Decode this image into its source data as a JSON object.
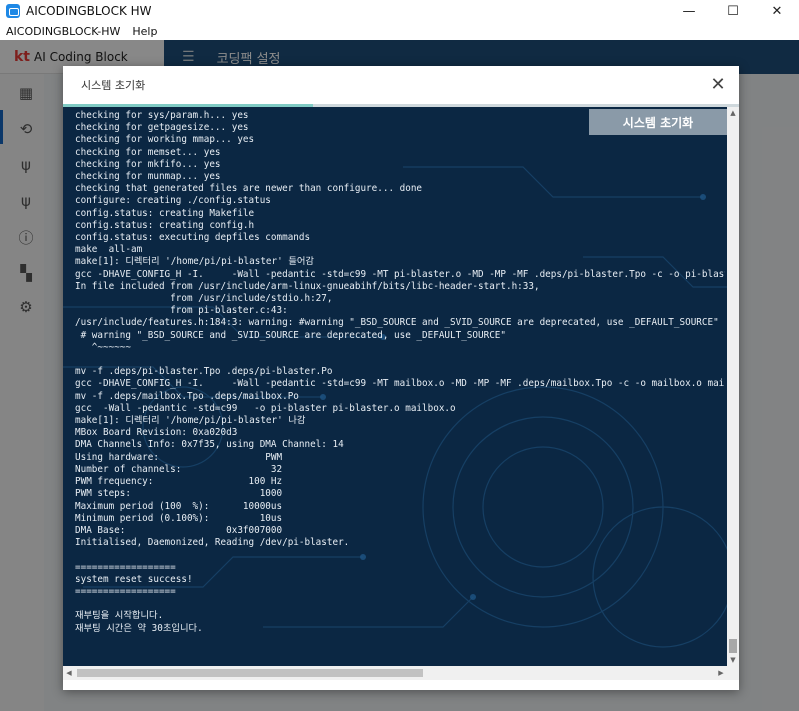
{
  "window": {
    "title": "AICODINGBLOCK HW",
    "minimize": "—",
    "maximize": "☐",
    "close": "✕"
  },
  "menu": [
    "AICODINGBLOCK-HW",
    "Help"
  ],
  "app": {
    "brand_mark": "kt",
    "brand_name": "AI Coding Block",
    "nav_title": "코딩팩 설정",
    "sidebar_icons": [
      "dashboard-icon",
      "connect-icon",
      "usb-icon",
      "usb-icon",
      "info-icon",
      "layout-icon",
      "settings-icon"
    ]
  },
  "modal": {
    "title": "시스템 초기화",
    "close": "✕",
    "reset_button": "시스템 초기화",
    "progress": 0.37,
    "log_lines": [
      "checking for sys/param.h... yes",
      "checking for getpagesize... yes",
      "checking for working mmap... yes",
      "checking for memset... yes",
      "checking for mkfifo... yes",
      "checking for munmap... yes",
      "checking that generated files are newer than configure... done",
      "configure: creating ./config.status",
      "config.status: creating Makefile",
      "config.status: creating config.h",
      "config.status: executing depfiles commands",
      "make  all-am",
      "make[1]: 디렉터리 '/home/pi/pi-blaster' 들어감",
      "gcc -DHAVE_CONFIG_H -I.     -Wall -pedantic -std=c99 -MT pi-blaster.o -MD -MP -MF .deps/pi-blaster.Tpo -c -o pi-blaster.o pi-bl",
      "In file included from /usr/include/arm-linux-gnueabihf/bits/libc-header-start.h:33,",
      "                 from /usr/include/stdio.h:27,",
      "                 from pi-blaster.c:43:",
      "/usr/include/features.h:184:3: warning: #warning \"_BSD_SOURCE and _SVID_SOURCE are deprecated, use _DEFAULT_SOURCE\" [-Wcpp]",
      " # warning \"_BSD_SOURCE and _SVID_SOURCE are deprecated, use _DEFAULT_SOURCE\"",
      "   ^~~~~~~",
      "",
      "mv -f .deps/pi-blaster.Tpo .deps/pi-blaster.Po",
      "gcc -DHAVE_CONFIG_H -I.     -Wall -pedantic -std=c99 -MT mailbox.o -MD -MP -MF .deps/mailbox.Tpo -c -o mailbox.o mailbox.c",
      "mv -f .deps/mailbox.Tpo .deps/mailbox.Po",
      "gcc  -Wall -pedantic -std=c99   -o pi-blaster pi-blaster.o mailbox.o",
      "make[1]: 디렉터리 '/home/pi/pi-blaster' 나감",
      "MBox Board Revision: 0xa020d3",
      "DMA Channels Info: 0x7f35, using DMA Channel: 14",
      "Using hardware:                   PWM",
      "Number of channels:                32",
      "PWM frequency:                 100 Hz",
      "PWM steps:                       1000",
      "Maximum period (100  %):      10000us",
      "Minimum period (0.100%):         10us",
      "DMA Base:                  0x3f007000",
      "Initialised, Daemonized, Reading /dev/pi-blaster.",
      "",
      "==================",
      "system reset success!",
      "==================",
      "",
      "재부팅을 시작합니다.",
      "재부팅 시간은 약 30초입니다."
    ]
  }
}
